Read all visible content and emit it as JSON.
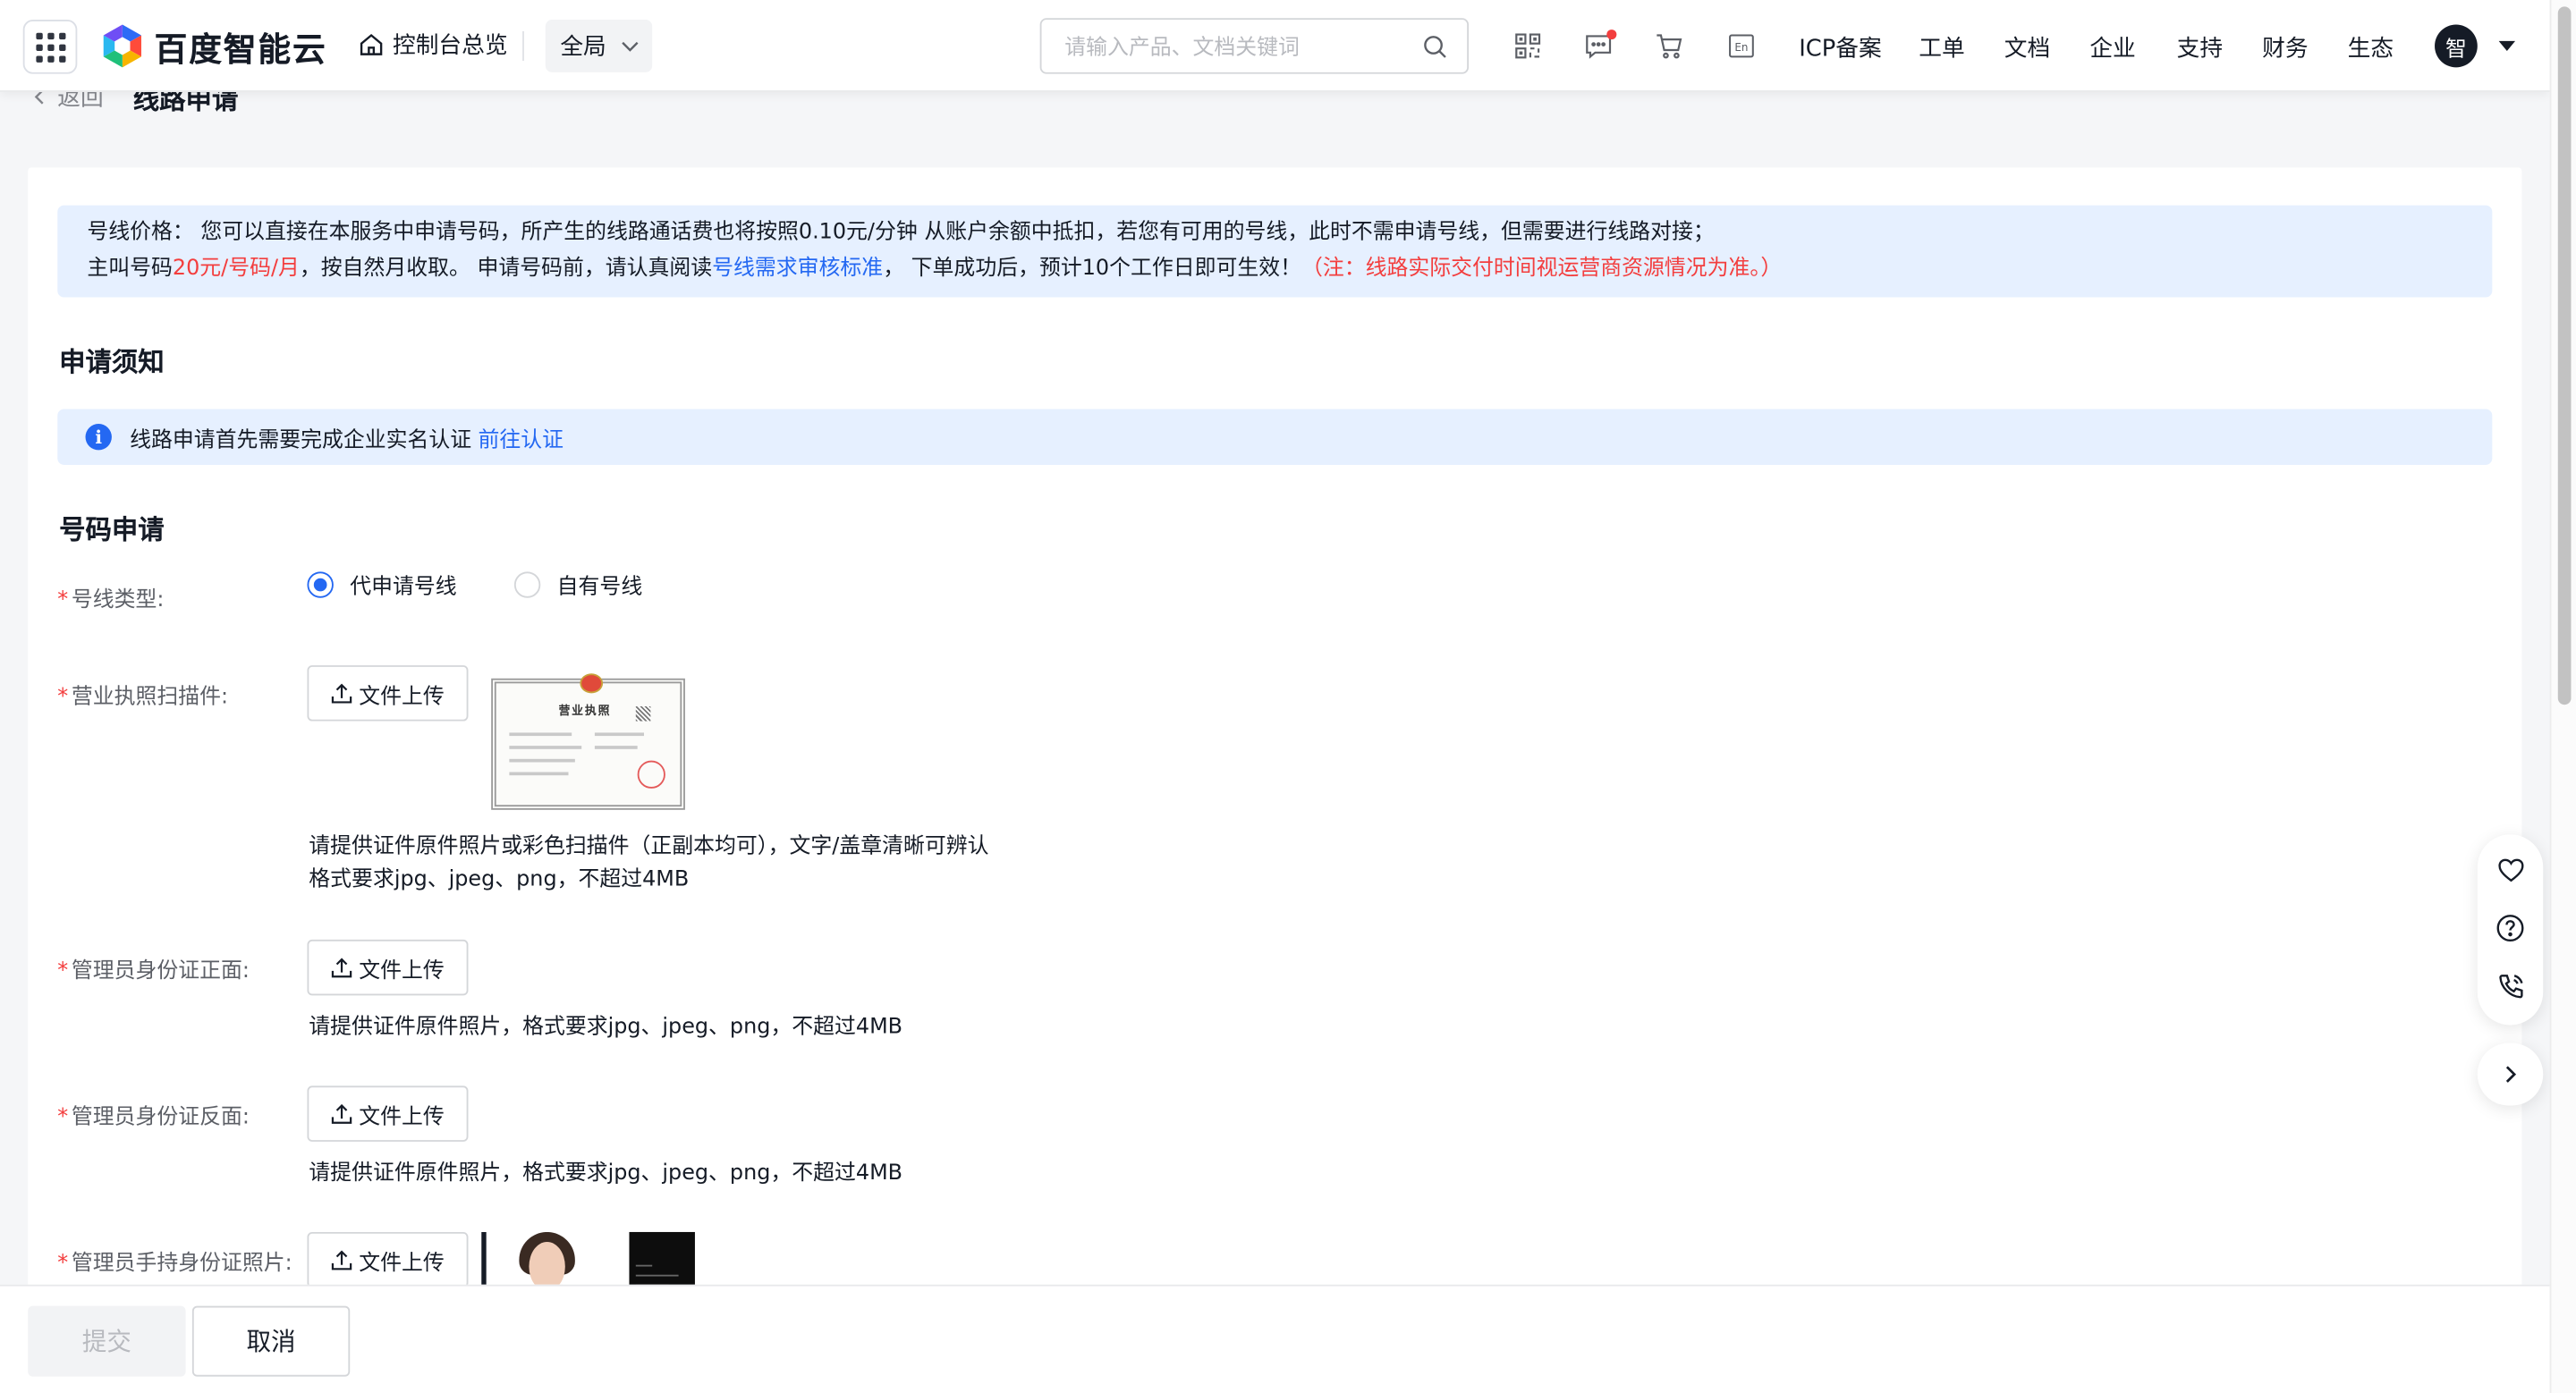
{
  "header": {
    "brand_name": "百度智能云",
    "console_home": "控制台总览",
    "scope": "全局",
    "search_placeholder": "请输入产品、文档关键词",
    "nav_links": [
      "ICP备案",
      "工单",
      "文档",
      "企业",
      "支持",
      "财务",
      "生态"
    ],
    "avatar_initial": "智"
  },
  "breadcrumb": {
    "back_label": "返回",
    "page_title": "线路申请"
  },
  "price_notice": {
    "line1": "号线价格：  您可以直接在本服务中申请号码，所产生的线路通话费也将按照0.10元/分钟 从账户余额中抵扣，若您有可用的号线，此时不需申请号线，但需要进行线路对接；",
    "line2_prefix": "主叫号码",
    "line2_price": "20元/号码/月",
    "line2_middle": "，按自然月收取。 申请号码前，请认真阅读",
    "line2_link": "号线需求审核标准",
    "line2_after_link": "， 下单成功后，预计10个工作日即可生效！",
    "line2_note": "（注：线路实际交付时间视运营商资源情况为准。）"
  },
  "notice_section": {
    "title": "申请须知",
    "info_text": "线路申请首先需要完成企业实名认证",
    "info_link": "前往认证"
  },
  "form": {
    "title": "号码申请",
    "line_type": {
      "label": "号线类型:",
      "options": [
        "代申请号线",
        "自有号线"
      ],
      "selected": "代申请号线"
    },
    "license": {
      "label": "营业执照扫描件:",
      "upload_label": "文件上传",
      "thumb_title": "营业执照",
      "hint_line1": "请提供证件原件照片或彩色扫描件（正副本均可），文字/盖章清晰可辨认",
      "hint_line2": "格式要求jpg、jpeg、png，不超过4MB"
    },
    "id_front": {
      "label": "管理员身份证正面:",
      "upload_label": "文件上传",
      "hint": "请提供证件原件照片，格式要求jpg、jpeg、png，不超过4MB"
    },
    "id_back": {
      "label": "管理员身份证反面:",
      "upload_label": "文件上传",
      "hint": "请提供证件原件照片，格式要求jpg、jpeg、png，不超过4MB"
    },
    "id_holding": {
      "label": "管理员手持身份证照片:",
      "upload_label": "文件上传"
    }
  },
  "footer": {
    "submit_label": "提交",
    "cancel_label": "取消"
  },
  "colors": {
    "primary": "#2468f2",
    "danger": "#f33e3e",
    "notice_bg": "#e6f0ff",
    "page_bg": "#f5f6f8"
  },
  "icons": {
    "apps": "grid-icon",
    "home": "home-icon",
    "search": "search-icon",
    "qr": "qrcode-icon",
    "message": "message-icon",
    "cart": "cart-icon",
    "language": "language-icon",
    "favorite": "heart-icon",
    "help": "help-icon",
    "phone": "phone-icon",
    "toggle": "chevron-right-icon"
  }
}
